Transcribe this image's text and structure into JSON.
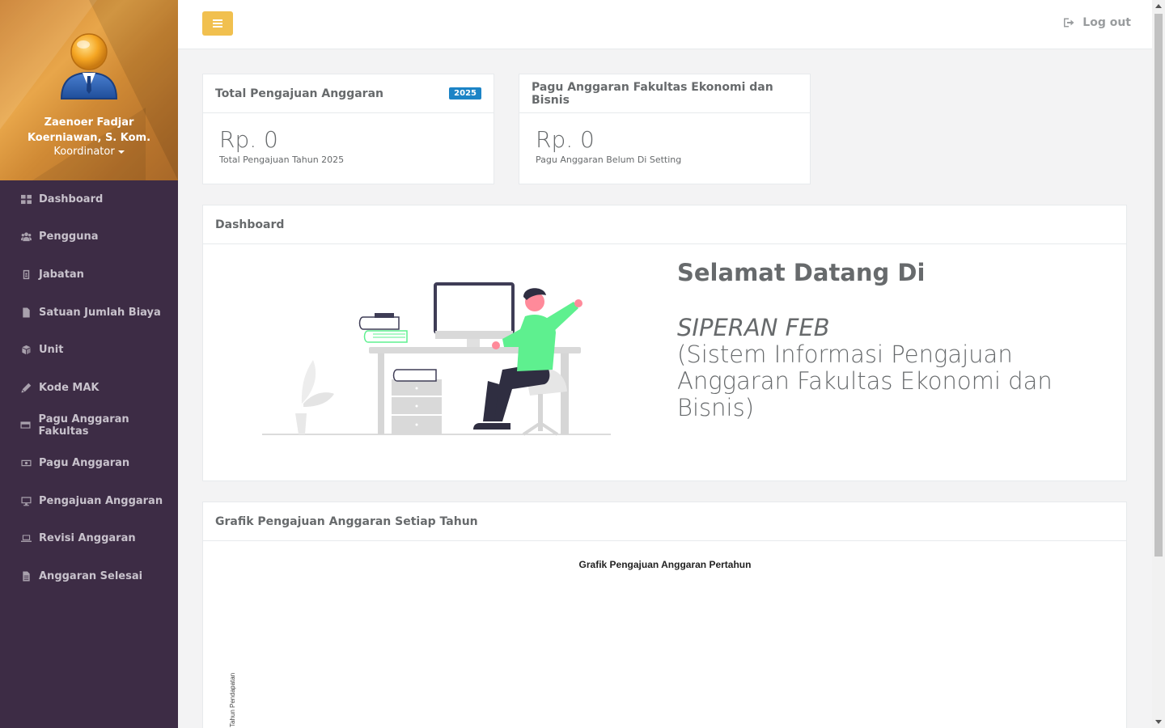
{
  "profile": {
    "name_line1": "Zaenoer Fadjar",
    "name_line2": "Koerniawan, S. Kom.",
    "role": "Koordinator"
  },
  "sidebar": {
    "items": [
      {
        "label": "Dashboard",
        "icon": "th-large-icon"
      },
      {
        "label": "Pengguna",
        "icon": "users-icon"
      },
      {
        "label": "Jabatan",
        "icon": "id-badge-icon"
      },
      {
        "label": "Satuan Jumlah Biaya",
        "icon": "file-icon"
      },
      {
        "label": "Unit",
        "icon": "cube-icon"
      },
      {
        "label": "Kode MAK",
        "icon": "pencil-icon"
      },
      {
        "label": "Pagu Anggaran Fakultas",
        "icon": "credit-card-icon"
      },
      {
        "label": "Pagu Anggaran",
        "icon": "money-icon"
      },
      {
        "label": "Pengajuan Anggaran",
        "icon": "desktop-icon"
      },
      {
        "label": "Revisi Anggaran",
        "icon": "laptop-icon"
      },
      {
        "label": "Anggaran Selesai",
        "icon": "file-text-icon"
      }
    ]
  },
  "topbar": {
    "logout_label": "Log out"
  },
  "stats": {
    "total": {
      "title": "Total Pengajuan Anggaran",
      "badge": "2025",
      "value": "Rp. 0",
      "sub": "Total Pengajuan Tahun 2025"
    },
    "pagu": {
      "title": "Pagu Anggaran Fakultas Ekonomi dan Bisnis",
      "value": "Rp. 0",
      "sub": "Pagu Anggaran Belum Di Setting"
    }
  },
  "dashboard": {
    "title": "Dashboard",
    "welcome": "Selamat Datang Di",
    "app_name": "SIPERAN FEB",
    "app_desc": "(Sistem Informasi Pengajuan Anggaran Fakultas Ekonomi dan Bisnis)"
  },
  "grafik": {
    "title": "Grafik Pengajuan Anggaran Setiap Tahun"
  },
  "chart_data": {
    "type": "bar",
    "title": "Grafik Pengajuan Anggaran Pertahun",
    "ylabel": "Tahun Pendapatan",
    "categories": [],
    "values": []
  },
  "colors": {
    "sidebar_bg": "#3d2c45",
    "menu_button": "#f1c04f",
    "badge": "#1c84c6",
    "illustration_accent": "#5ef08f"
  }
}
